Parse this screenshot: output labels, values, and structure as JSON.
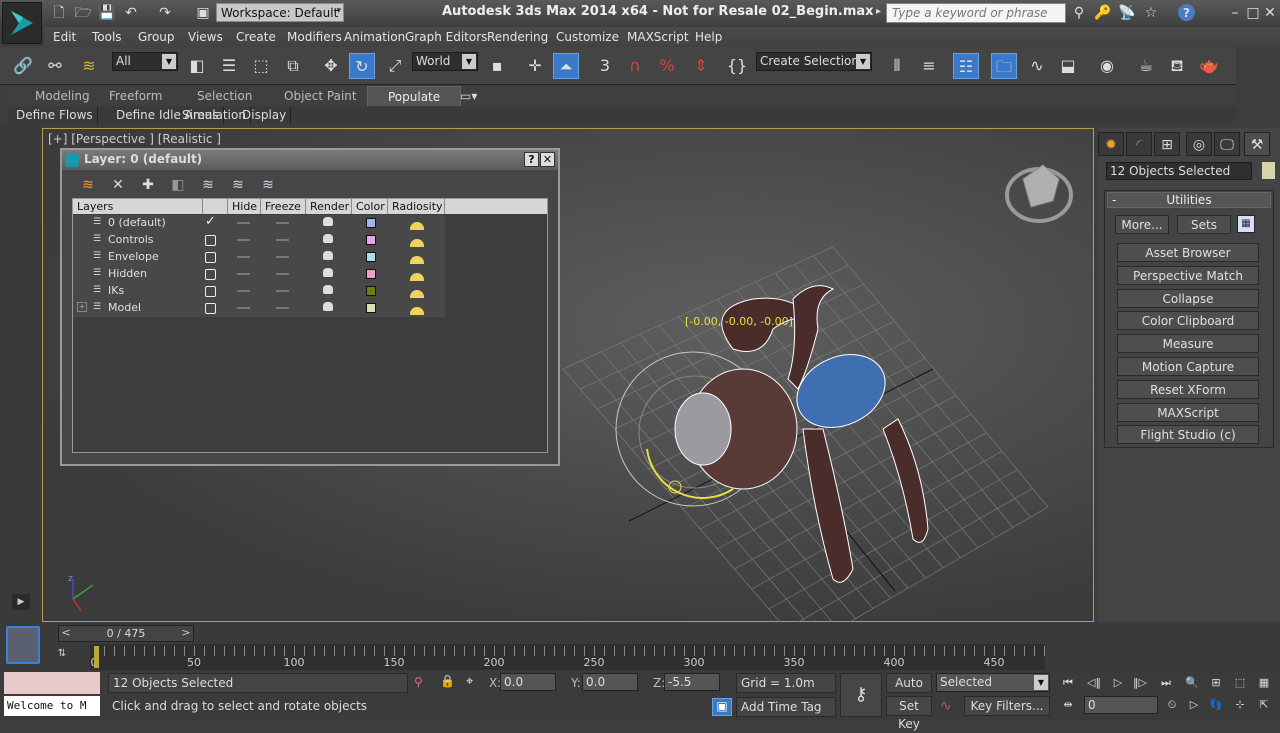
{
  "window": {
    "title": "Autodesk 3ds Max  2014 x64  - Not for Resale   02_Begin.max",
    "workspace": "Workspace: Default",
    "search_placeholder": "Type a keyword or phrase"
  },
  "menu": [
    "Edit",
    "Tools",
    "Group",
    "Views",
    "Create",
    "Modifiers",
    "Animation",
    "Graph Editors",
    "Rendering",
    "Customize",
    "MAXScript",
    "Help"
  ],
  "toolbar": {
    "selection_filter": "All",
    "reference_coord": "World",
    "snap_label": "3",
    "named_selection_placeholder": "Create Selection Set",
    "active_tool": "select-and-rotate"
  },
  "ribbon": {
    "tabs": [
      "Modeling",
      "Freeform",
      "Selection",
      "Object Paint",
      "Populate"
    ],
    "active_tab": "Populate",
    "subtabs": [
      "Define Flows",
      "Define Idle Areas",
      "Simulation",
      "Display"
    ]
  },
  "viewport": {
    "label": "[+] [Perspective ] [Realistic ]",
    "gizmo_readout": "[-0.00, -0.00, -0.00]",
    "axis_label": "z"
  },
  "layer_dialog": {
    "title": "Layer: 0 (default)",
    "help_label": "?",
    "close_label": "✕",
    "columns": [
      "Layers",
      "",
      "Hide",
      "Freeze",
      "Render",
      "Color",
      "Radiosity"
    ],
    "layers": [
      {
        "name": "0 (default)",
        "current": true,
        "color": "#9fb4e8",
        "expandable": false
      },
      {
        "name": "Controls",
        "current": false,
        "color": "#e6a6e3",
        "expandable": false
      },
      {
        "name": "Envelope",
        "current": false,
        "color": "#a6dde8",
        "expandable": false
      },
      {
        "name": "Hidden",
        "current": false,
        "color": "#e8a0c4",
        "expandable": false
      },
      {
        "name": "IKs",
        "current": false,
        "color": "#6b7f12",
        "expandable": false
      },
      {
        "name": "Model",
        "current": false,
        "color": "#d8e0b0",
        "expandable": true
      }
    ]
  },
  "command_panel": {
    "selection_name": "12 Objects Selected",
    "selection_color": "#d6d4a8",
    "rollout_title": "Utilities",
    "rollout_toggle": "-",
    "more_label": "More...",
    "sets_label": "Sets",
    "utilities": [
      "Asset Browser",
      "Perspective Match",
      "Collapse",
      "Color Clipboard",
      "Measure",
      "Motion Capture",
      "Reset XForm",
      "MAXScript",
      "Flight Studio (c)"
    ]
  },
  "timeline": {
    "current_frame": 0,
    "total_frames": 475,
    "slider_label": "0 / 475",
    "prev_label": "<",
    "next_label": ">",
    "ruler_labels": [
      "0",
      "50",
      "100",
      "150",
      "200",
      "250",
      "300",
      "350",
      "400",
      "450"
    ]
  },
  "status": {
    "listener_text": "Welcome to M",
    "selection_info": "12 Objects Selected",
    "prompt": "Click and drag to select and rotate objects",
    "x_label": "X:",
    "x_value": "0.0",
    "y_label": "Y:",
    "y_value": "0.0",
    "z_label": "Z:",
    "z_value": "-5.5",
    "grid": "Grid = 1.0m",
    "add_time_tag": "Add Time Tag",
    "auto_key": "Auto Key",
    "set_key": "Set Key",
    "key_mode": "Selected",
    "key_filters": "Key Filters...",
    "frame_field": "0"
  }
}
